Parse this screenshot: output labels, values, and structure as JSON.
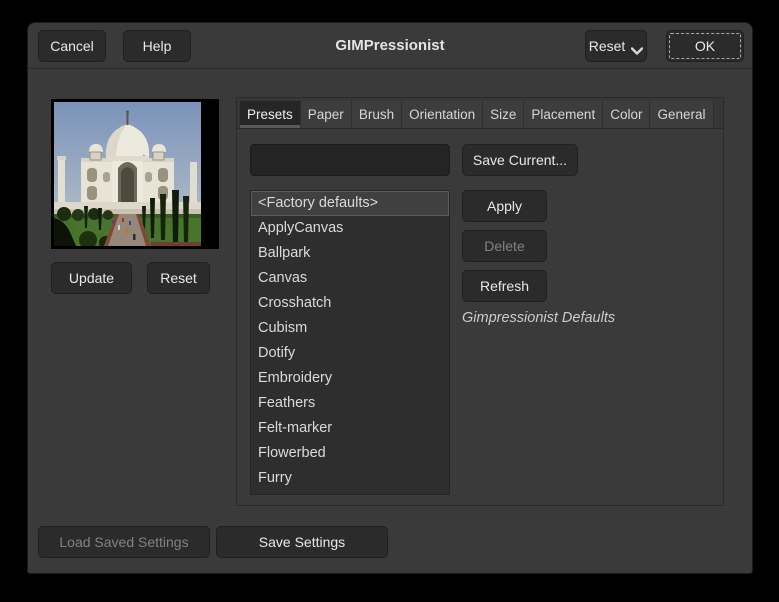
{
  "header": {
    "title": "GIMPressionist",
    "cancel_label": "Cancel",
    "help_label": "Help",
    "reset_label": "Reset",
    "ok_label": "OK"
  },
  "preview": {
    "update_label": "Update",
    "reset_label": "Reset"
  },
  "tabs": [
    {
      "label": "Presets",
      "active": true
    },
    {
      "label": "Paper",
      "active": false
    },
    {
      "label": "Brush",
      "active": false
    },
    {
      "label": "Orientation",
      "active": false
    },
    {
      "label": "Size",
      "active": false
    },
    {
      "label": "Placement",
      "active": false
    },
    {
      "label": "Color",
      "active": false
    },
    {
      "label": "General",
      "active": false
    }
  ],
  "presets": {
    "name_input_value": "",
    "save_current_label": "Save Current...",
    "items": [
      {
        "label": "<Factory defaults>",
        "active": true
      },
      {
        "label": "ApplyCanvas",
        "active": false
      },
      {
        "label": "Ballpark",
        "active": false
      },
      {
        "label": "Canvas",
        "active": false
      },
      {
        "label": "Crosshatch",
        "active": false
      },
      {
        "label": "Cubism",
        "active": false
      },
      {
        "label": "Dotify",
        "active": false
      },
      {
        "label": "Embroidery",
        "active": false
      },
      {
        "label": "Feathers",
        "active": false
      },
      {
        "label": "Felt-marker",
        "active": false
      },
      {
        "label": "Flowerbed",
        "active": false
      },
      {
        "label": "Furry",
        "active": false
      }
    ],
    "selected_preset": "<Factory defaults>",
    "apply_label": "Apply",
    "delete_label": "Delete",
    "refresh_label": "Refresh",
    "description": "Gimpressionist Defaults"
  },
  "footer": {
    "load_saved_label": "Load Saved Settings",
    "save_settings_label": "Save Settings"
  },
  "colors": {
    "outer_bg": "#000000",
    "window_bg": "#3a3a3a",
    "button_bg": "#2b2b2b",
    "button_text": "#e8e8e8",
    "disabled_text": "#828282",
    "input_bg": "#242424",
    "list_bg": "#2e2e2e",
    "selected_row_bg": "#404040",
    "active_tab_bg": "#262626"
  }
}
